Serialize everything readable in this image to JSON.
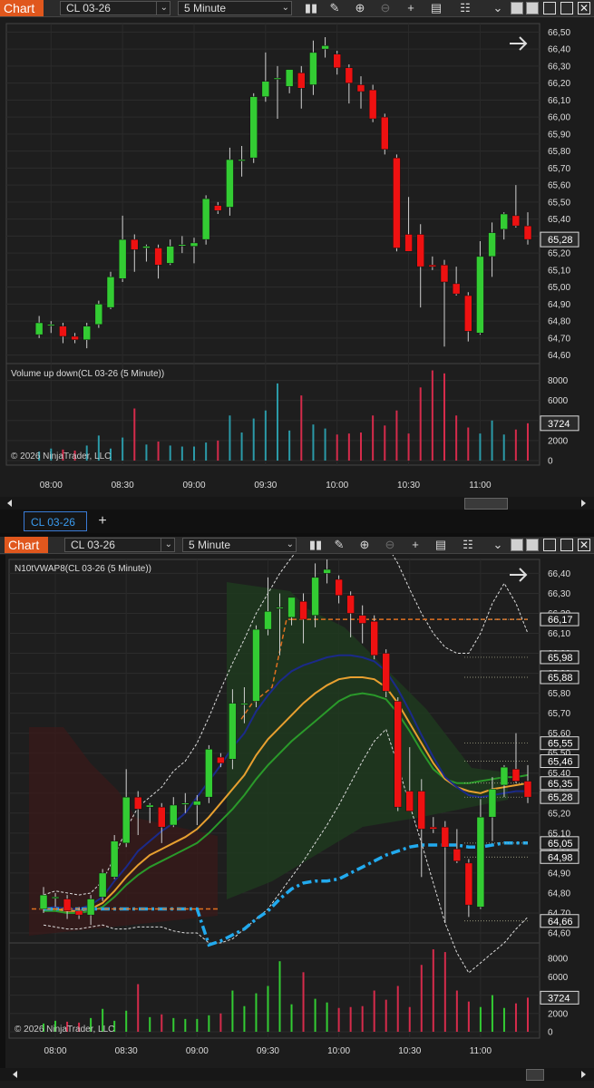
{
  "windows": [
    {
      "toolbar": {
        "brand": "Chart",
        "instrument": "CL 03-26",
        "interval": "5 Minute"
      },
      "panel_label": "",
      "volume_label": "Volume up down(CL 03-26 (5 Minute))",
      "copyright": "© 2026 NinjaTrader, LLC",
      "price_ticks": [
        "66,50",
        "66,40",
        "66,30",
        "66,20",
        "66,10",
        "66,00",
        "65,90",
        "65,80",
        "65,70",
        "65,60",
        "65,50",
        "65,40",
        "65,30",
        "65,20",
        "65,10",
        "65,00",
        "64,90",
        "64,80",
        "64,70",
        "64,60"
      ],
      "last_price_label": "65,28",
      "volume_ticks": [
        "8000",
        "6000",
        "4000",
        "2000",
        "0"
      ],
      "last_volume_label": "3724",
      "time_ticks": [
        "08:00",
        "08:30",
        "09:00",
        "09:30",
        "10:00",
        "10:30",
        "11:00"
      ]
    },
    {
      "toolbar": {
        "brand": "Chart",
        "instrument": "CL 03-26",
        "interval": "5 Minute"
      },
      "panel_label": "N10tVWAP8(CL 03-26 (5 Minute))",
      "volume_label": "",
      "copyright": "© 2026 NinjaTrader, LLC",
      "price_ticks": [
        "66,40",
        "66,30",
        "66,20",
        "66,10",
        "66,00",
        "65,90",
        "65,80",
        "65,70",
        "65,60",
        "65,50",
        "65,40",
        "65,30",
        "65,20",
        "65,10",
        "65,00",
        "64,90",
        "64,80",
        "64,70",
        "64,60"
      ],
      "level_labels": [
        "66,17",
        "65,98",
        "65,88",
        "65,55",
        "65,46",
        "65,35",
        "65,28",
        "65,05",
        "64,98",
        "64,66"
      ],
      "volume_ticks": [
        "8000",
        "6000",
        "4000",
        "2000",
        "0"
      ],
      "last_volume_label": "3724",
      "time_ticks": [
        "08:00",
        "08:30",
        "09:00",
        "09:30",
        "10:00",
        "10:30",
        "11:00"
      ]
    }
  ],
  "tabs": [
    {
      "label": "CL 03-26",
      "active": true
    }
  ],
  "tab_add": "+",
  "colors": {
    "up": "#33cc33",
    "down": "#ee1111",
    "vol_up_top": "#2b9aa8",
    "vol_up_bottom": "#33cc33",
    "vol_down": "#d52b4b",
    "brand": "#e0571d",
    "vwap_blue": "#22aaee",
    "band_orange": "#e8a030",
    "band_green": "#2a9a2a",
    "band_navy": "#1b2a8a",
    "level_orange": "#e07020"
  },
  "chart_data": [
    {
      "type": "candlestick",
      "title": "",
      "instrument": "CL 03-26",
      "interval": "5 Minute",
      "ylim": [
        64.55,
        66.55
      ],
      "time_range": [
        "07:50",
        "11:20"
      ],
      "candles": [
        {
          "t": "07:55",
          "o": 64.72,
          "h": 64.83,
          "l": 64.7,
          "c": 64.79
        },
        {
          "t": "08:00",
          "o": 64.78,
          "h": 64.8,
          "l": 64.73,
          "c": 64.78
        },
        {
          "t": "08:05",
          "o": 64.77,
          "h": 64.79,
          "l": 64.67,
          "c": 64.71
        },
        {
          "t": "08:10",
          "o": 64.71,
          "h": 64.73,
          "l": 64.67,
          "c": 64.69
        },
        {
          "t": "08:15",
          "o": 64.69,
          "h": 64.79,
          "l": 64.64,
          "c": 64.77
        },
        {
          "t": "08:20",
          "o": 64.78,
          "h": 64.92,
          "l": 64.76,
          "c": 64.9
        },
        {
          "t": "08:25",
          "o": 64.88,
          "h": 65.09,
          "l": 64.87,
          "c": 65.06
        },
        {
          "t": "08:30",
          "o": 65.05,
          "h": 65.42,
          "l": 65.03,
          "c": 65.28
        },
        {
          "t": "08:35",
          "o": 65.28,
          "h": 65.31,
          "l": 65.09,
          "c": 65.22
        },
        {
          "t": "08:40",
          "o": 65.23,
          "h": 65.25,
          "l": 65.15,
          "c": 65.24
        },
        {
          "t": "08:45",
          "o": 65.23,
          "h": 65.25,
          "l": 65.05,
          "c": 65.13
        },
        {
          "t": "08:50",
          "o": 65.14,
          "h": 65.28,
          "l": 65.13,
          "c": 65.24
        },
        {
          "t": "08:55",
          "o": 65.25,
          "h": 65.3,
          "l": 65.2,
          "c": 65.25
        },
        {
          "t": "09:00",
          "o": 65.24,
          "h": 65.29,
          "l": 65.14,
          "c": 65.26
        },
        {
          "t": "09:05",
          "o": 65.28,
          "h": 65.54,
          "l": 65.25,
          "c": 65.52
        },
        {
          "t": "09:10",
          "o": 65.48,
          "h": 65.5,
          "l": 65.43,
          "c": 65.45
        },
        {
          "t": "09:15",
          "o": 65.47,
          "h": 65.82,
          "l": 65.42,
          "c": 65.75
        },
        {
          "t": "09:20",
          "o": 65.75,
          "h": 65.83,
          "l": 65.65,
          "c": 65.75
        },
        {
          "t": "09:25",
          "o": 65.76,
          "h": 66.14,
          "l": 65.73,
          "c": 66.12
        },
        {
          "t": "09:30",
          "o": 66.12,
          "h": 66.38,
          "l": 66.09,
          "c": 66.21
        },
        {
          "t": "09:35",
          "o": 66.23,
          "h": 66.3,
          "l": 65.99,
          "c": 66.23
        },
        {
          "t": "09:40",
          "o": 66.18,
          "h": 66.26,
          "l": 66.14,
          "c": 66.28
        },
        {
          "t": "09:45",
          "o": 66.26,
          "h": 66.3,
          "l": 66.05,
          "c": 66.17
        },
        {
          "t": "09:50",
          "o": 66.19,
          "h": 66.45,
          "l": 66.13,
          "c": 66.38
        },
        {
          "t": "09:55",
          "o": 66.4,
          "h": 66.47,
          "l": 66.35,
          "c": 66.42
        },
        {
          "t": "10:00",
          "o": 66.37,
          "h": 66.39,
          "l": 66.25,
          "c": 66.29
        },
        {
          "t": "10:05",
          "o": 66.29,
          "h": 66.31,
          "l": 66.08,
          "c": 66.2
        },
        {
          "t": "10:10",
          "o": 66.19,
          "h": 66.24,
          "l": 66.05,
          "c": 66.15
        },
        {
          "t": "10:15",
          "o": 66.16,
          "h": 66.19,
          "l": 65.97,
          "c": 65.99
        },
        {
          "t": "10:20",
          "o": 66.0,
          "h": 66.02,
          "l": 65.78,
          "c": 65.81
        },
        {
          "t": "10:25",
          "o": 65.76,
          "h": 65.78,
          "l": 65.21,
          "c": 65.23
        },
        {
          "t": "10:30",
          "o": 65.31,
          "h": 65.53,
          "l": 65.22,
          "c": 65.21
        },
        {
          "t": "10:35",
          "o": 65.31,
          "h": 65.37,
          "l": 64.88,
          "c": 65.12
        },
        {
          "t": "10:40",
          "o": 65.13,
          "h": 65.18,
          "l": 65.1,
          "c": 65.12
        },
        {
          "t": "10:45",
          "o": 65.13,
          "h": 65.16,
          "l": 64.65,
          "c": 65.03
        },
        {
          "t": "10:50",
          "o": 65.02,
          "h": 65.12,
          "l": 64.95,
          "c": 64.96
        },
        {
          "t": "10:55",
          "o": 64.95,
          "h": 64.97,
          "l": 64.68,
          "c": 64.74
        },
        {
          "t": "11:00",
          "o": 64.73,
          "h": 65.27,
          "l": 64.72,
          "c": 65.18
        },
        {
          "t": "11:05",
          "o": 65.18,
          "h": 65.38,
          "l": 65.06,
          "c": 65.32
        },
        {
          "t": "11:10",
          "o": 65.34,
          "h": 65.44,
          "l": 65.28,
          "c": 65.43
        },
        {
          "t": "11:15",
          "o": 65.42,
          "h": 65.6,
          "l": 65.35,
          "c": 65.36
        },
        {
          "t": "11:20",
          "o": 65.36,
          "h": 65.44,
          "l": 65.25,
          "c": 65.28
        }
      ],
      "volume": {
        "label": "Volume up down(CL 03-26 (5 Minute))",
        "ylim": [
          0,
          9500
        ],
        "values": [
          900,
          1200,
          1100,
          1000,
          1500,
          2500,
          1200,
          2300,
          5200,
          1600,
          1900,
          1500,
          1400,
          1400,
          1800,
          2000,
          4500,
          2800,
          4200,
          5000,
          7700,
          3000,
          6500,
          3600,
          3200,
          2600,
          2700,
          2800,
          4500,
          3500,
          5000,
          2700,
          7300,
          9000,
          8700,
          4500,
          3300,
          2700,
          4000,
          2600,
          3100,
          3724
        ]
      }
    },
    {
      "type": "candlestick",
      "title": "",
      "indicator": "N10tVWAP8(CL 03-26 (5 Minute))",
      "ylim": [
        64.55,
        66.47
      ],
      "time_range": [
        "07:50",
        "11:20"
      ],
      "vwap": [
        64.72,
        64.72,
        64.72,
        64.72,
        64.72,
        64.72,
        64.72,
        64.72,
        64.72,
        64.72,
        64.72,
        64.72,
        64.72,
        64.72,
        64.54,
        64.56,
        64.59,
        64.62,
        64.67,
        64.71,
        64.77,
        64.82,
        64.85,
        64.86,
        64.86,
        64.87,
        64.9,
        64.93,
        64.96,
        64.99,
        65.01,
        65.03,
        65.04,
        65.04,
        65.04,
        65.04,
        65.03,
        65.03,
        65.04,
        65.05,
        65.05,
        65.05
      ],
      "band_upper_1": [
        64.72,
        64.73,
        64.72,
        64.72,
        64.74,
        64.78,
        64.86,
        64.93,
        65.01,
        65.06,
        65.11,
        65.15,
        65.2,
        65.28,
        65.36,
        65.44,
        65.53,
        65.6,
        65.71,
        65.79,
        65.86,
        65.91,
        65.94,
        65.96,
        65.98,
        65.99,
        65.99,
        65.98,
        65.96,
        65.91,
        65.82,
        65.71,
        65.59,
        65.48,
        65.38,
        65.33,
        65.29,
        65.28,
        65.29,
        65.3,
        65.31,
        65.31
      ],
      "band_mid_1": [
        64.72,
        64.72,
        64.71,
        64.71,
        64.72,
        64.75,
        64.81,
        64.88,
        64.94,
        64.99,
        65.02,
        65.05,
        65.08,
        65.12,
        65.18,
        65.25,
        65.32,
        65.39,
        65.49,
        65.57,
        65.63,
        65.69,
        65.75,
        65.8,
        65.84,
        65.87,
        65.88,
        65.88,
        65.87,
        65.83,
        65.75,
        65.65,
        65.55,
        65.45,
        65.37,
        65.33,
        65.31,
        65.3,
        65.32,
        65.33,
        65.34,
        65.35
      ],
      "band_lower_1": [
        64.71,
        64.71,
        64.7,
        64.7,
        64.71,
        64.73,
        64.78,
        64.84,
        64.89,
        64.93,
        64.96,
        64.99,
        65.02,
        65.05,
        65.1,
        65.16,
        65.22,
        65.29,
        65.37,
        65.44,
        65.5,
        65.56,
        65.61,
        65.66,
        65.71,
        65.76,
        65.79,
        65.8,
        65.79,
        65.77,
        65.7,
        65.61,
        65.51,
        65.42,
        65.37,
        65.35,
        65.35,
        65.36,
        65.37,
        65.38,
        65.38,
        65.39
      ],
      "band_upper_2": [
        64.79,
        64.81,
        64.8,
        64.79,
        64.8,
        64.86,
        64.98,
        65.12,
        65.23,
        65.28,
        65.33,
        65.41,
        65.46,
        65.55,
        65.68,
        65.82,
        65.95,
        66.07,
        66.2,
        66.3,
        66.4,
        66.48,
        66.55,
        66.6,
        66.62,
        66.63,
        66.64,
        66.63,
        66.6,
        66.55,
        66.45,
        66.32,
        66.2,
        66.1,
        66.03,
        66.0,
        66.0,
        66.1,
        66.25,
        66.35,
        66.25,
        66.1
      ],
      "band_lower_2": [
        64.64,
        64.63,
        64.62,
        64.62,
        64.63,
        64.64,
        64.62,
        64.62,
        64.63,
        64.63,
        64.63,
        64.61,
        64.6,
        64.6,
        64.55,
        64.55,
        64.57,
        64.62,
        64.67,
        64.72,
        64.8,
        64.88,
        64.96,
        65.05,
        65.14,
        65.24,
        65.35,
        65.46,
        65.56,
        65.62,
        65.44,
        65.24,
        65.05,
        64.85,
        64.65,
        64.5,
        64.4,
        64.45,
        64.5,
        64.55,
        64.62,
        64.68
      ],
      "levels": [
        66.17,
        65.98,
        65.88,
        65.55,
        65.46,
        65.35,
        65.28,
        65.05,
        64.98,
        64.66
      ],
      "volume": {
        "ylim": [
          0,
          9500
        ],
        "values": [
          900,
          1200,
          1100,
          1000,
          1500,
          2500,
          1200,
          2300,
          5200,
          1600,
          1900,
          1500,
          1400,
          1400,
          1800,
          2000,
          4500,
          2800,
          4200,
          5000,
          7700,
          3000,
          6500,
          3600,
          3200,
          2600,
          2700,
          2800,
          4500,
          3500,
          5000,
          2700,
          7300,
          9000,
          8700,
          4500,
          3300,
          2700,
          4000,
          2600,
          3100,
          3724
        ]
      }
    }
  ]
}
